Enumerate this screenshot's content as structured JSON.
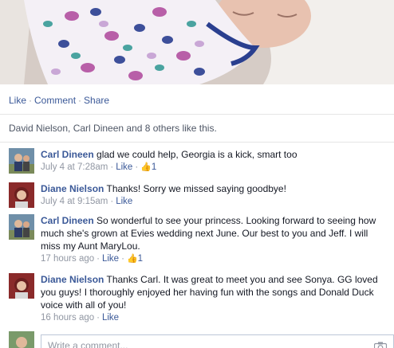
{
  "post": {
    "actions": {
      "like": "Like",
      "comment": "Comment",
      "share": "Share",
      "separator": "·"
    },
    "likes_summary": "David Nielson, Carl Dineen and 8 others like this."
  },
  "comments": [
    {
      "author": "Carl Dineen",
      "text": "glad we could help, Georgia is a kick, smart too",
      "time": "July 4 at 7:28am",
      "like": "Like",
      "likes": "1"
    },
    {
      "author": "Diane Nielson",
      "text": "Thanks! Sorry we missed saying goodbye!",
      "time": "July 4 at 9:15am",
      "like": "Like"
    },
    {
      "author": "Carl Dineen",
      "text": "So wonderful to see your princess. Looking forward to seeing how much she's grown at Evies wedding next June. Our best to you and Jeff. I will miss my Aunt MaryLou.",
      "time": "17 hours ago",
      "like": "Like",
      "likes": "1"
    },
    {
      "author": "Diane Nielson",
      "text": "Thanks Carl. It was great to meet you and see Sonya. GG loved you guys! I thoroughly enjoyed her having fun with the songs and Donald Duck voice with all of you!",
      "time": "16 hours ago",
      "like": "Like"
    }
  ],
  "composer": {
    "placeholder": "Write a comment..."
  },
  "colors": {
    "link": "#3b5998",
    "meta": "#9197a3",
    "text": "#141823"
  }
}
